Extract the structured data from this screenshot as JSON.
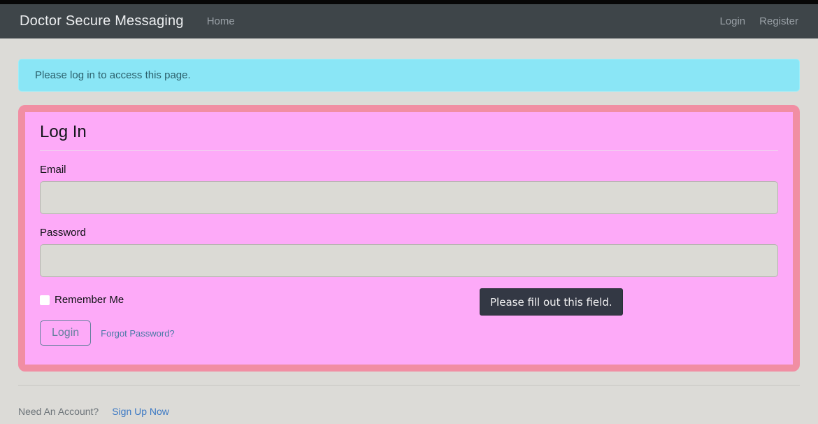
{
  "navbar": {
    "brand": "Doctor Secure Messaging",
    "links": [
      {
        "label": "Home"
      }
    ],
    "right_links": [
      {
        "label": "Login"
      },
      {
        "label": "Register"
      }
    ]
  },
  "alert": {
    "message": "Please log in to access this page."
  },
  "login_form": {
    "title": "Log In",
    "email_label": "Email",
    "email_value": "",
    "password_label": "Password",
    "password_value": "",
    "remember_label": "Remember Me",
    "remember_checked": false,
    "login_button": "Login",
    "forgot_link": "Forgot Password?"
  },
  "tooltip": {
    "text": "Please fill out this field."
  },
  "footer": {
    "prompt": "Need An Account?",
    "signup_link": "Sign Up Now"
  },
  "colors": {
    "navbar_bg": "#3e4549",
    "alert_bg": "#8ae6f6",
    "card_border": "#f18ea3",
    "card_bg": "#fdaaf8",
    "input_bg": "#dbdad5",
    "tooltip_bg": "#333844",
    "button_accent": "#64809d",
    "link_blue": "#3c79c4"
  }
}
